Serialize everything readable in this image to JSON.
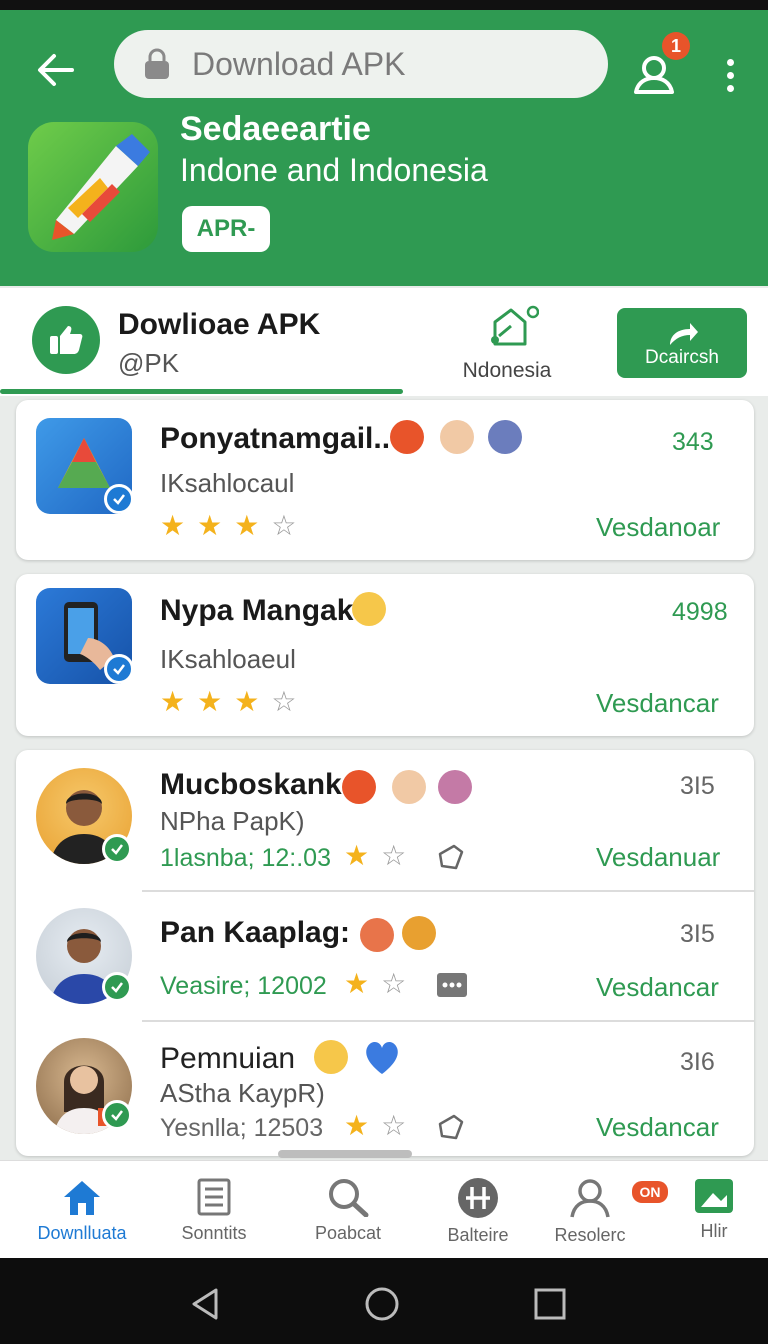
{
  "header": {
    "search_placeholder": "Download APK",
    "notification_count": "1",
    "app_title": "Sedaeeartie",
    "app_subtitle": "Indone and Indonesia",
    "apk_chip": "APR-"
  },
  "info_strip": {
    "title": "Dowlioae APK",
    "subtitle": "@PK",
    "region_label": "Ndonesia",
    "download_label": "Dcaircsh"
  },
  "apps": [
    {
      "name": "Ponyatnamgail..",
      "developer": "IKsahlocaul",
      "count": "343",
      "action": "Vesdanoar",
      "rating": 3
    },
    {
      "name": "Nypa Mangak",
      "developer": "IKsahloaeul",
      "count": "4998",
      "action": "Vesdancar",
      "rating": 3
    }
  ],
  "people": [
    {
      "name": "Mucboskank",
      "subtitle": "NPha PapK)",
      "meta": "1lasnba; 12:.03",
      "count": "3I5",
      "action": "Vesdanuar",
      "rating": 1
    },
    {
      "name": "Pan Kaaplag:",
      "meta": "Veasire; 12002",
      "count": "3I5",
      "action": "Vesdancar",
      "rating": 1
    },
    {
      "name": "Pemnuian",
      "subtitle": "AStha KaypR)",
      "meta": "Yesnlla; 12503",
      "count": "3I6",
      "action": "Vesdancar",
      "rating": 1
    }
  ],
  "bottom_nav": {
    "items": [
      "Downlluata",
      "Sonntits",
      "Poabcat",
      "Balteire",
      "Resolerc",
      "Hlir"
    ],
    "badge": "ON",
    "active_index": 0
  },
  "colors": {
    "primary_green": "#2f9a52",
    "accent_blue": "#1e7ad4",
    "badge_orange": "#e8542a",
    "star": "#f4b21c"
  },
  "icons": [
    "back-arrow-icon",
    "lock-icon",
    "account-icon",
    "more-vert-icon",
    "share-icon",
    "home-icon",
    "document-icon",
    "search-icon",
    "hashtag-icon",
    "person-icon",
    "image-icon"
  ]
}
